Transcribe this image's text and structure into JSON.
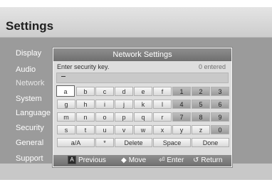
{
  "header": {
    "title": "Settings"
  },
  "menu": {
    "items": [
      {
        "label": "Display"
      },
      {
        "label": "Audio"
      },
      {
        "label": "Network"
      },
      {
        "label": "System"
      },
      {
        "label": "Language"
      },
      {
        "label": "Security"
      },
      {
        "label": "General"
      },
      {
        "label": "Support"
      }
    ],
    "active_index": 2
  },
  "dialog": {
    "title": "Network Settings",
    "prompt": "Enter security key.",
    "entered_text": "0 entered",
    "input_value": "_",
    "keys": {
      "row1": [
        "a",
        "b",
        "c",
        "d",
        "e",
        "f",
        "1",
        "2",
        "3"
      ],
      "row2": [
        "g",
        "h",
        "i",
        "j",
        "k",
        "l",
        "4",
        "5",
        "6"
      ],
      "row3": [
        "m",
        "n",
        "o",
        "p",
        "q",
        "r",
        "7",
        "8",
        "9"
      ],
      "row4": [
        "s",
        "t",
        "u",
        "v",
        "w",
        "x",
        "y",
        "z",
        "0"
      ],
      "row5": [
        "a/A",
        "*",
        "Delete",
        "Space",
        "Done"
      ]
    },
    "selected_key": "a",
    "footer": {
      "previous": {
        "badge": "A",
        "label": "Previous"
      },
      "move": {
        "icon": "◆",
        "label": "Move"
      },
      "enter": {
        "icon": "⏎",
        "label": "Enter"
      },
      "return": {
        "icon": "↺",
        "label": "Return"
      }
    }
  }
}
